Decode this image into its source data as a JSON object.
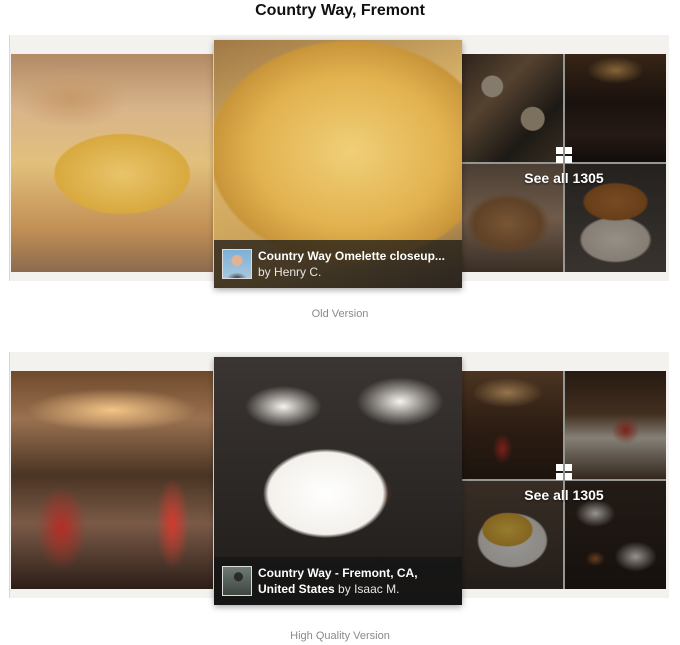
{
  "title": "Country Way, Fremont",
  "old_version": {
    "label": "Old Version",
    "caption_title": "Country Way Omelette closeup...",
    "caption_by": "by",
    "caption_author": "Henry C.",
    "see_all": "See all 1305"
  },
  "hq_version": {
    "label": "High Quality Version",
    "caption_title_line1": "Country Way - Fremont, CA,",
    "caption_title_line2": "United States",
    "caption_by": "by",
    "caption_author": "Isaac M.",
    "see_all": "See all 1305"
  },
  "icons": {
    "see_all": "grid-icon"
  }
}
